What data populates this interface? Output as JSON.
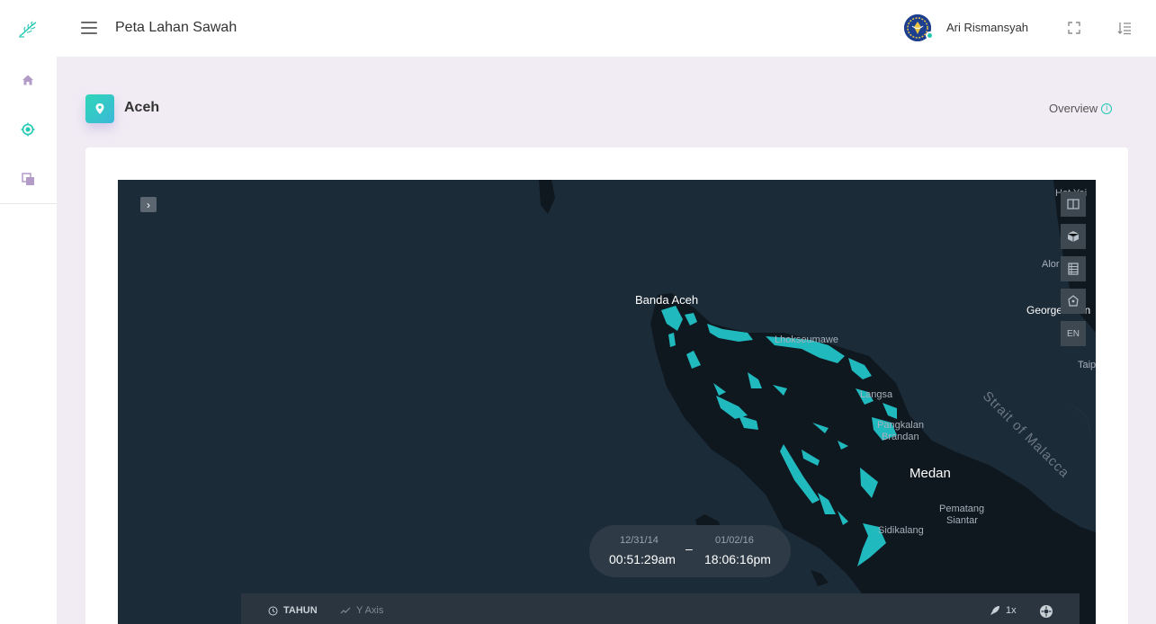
{
  "header": {
    "title": "Peta Lahan Sawah",
    "username": "Ari Rismansyah"
  },
  "page": {
    "title": "Aceh",
    "overview_label": "Overview"
  },
  "map": {
    "labels": {
      "banda_aceh": "Banda Aceh",
      "lhokseumawe": "Lhokseumawe",
      "langsa": "Langsa",
      "pangkalan_brandan_1": "Pangkalan",
      "pangkalan_brandan_2": "Brandan",
      "medan": "Medan",
      "pematang_siantar_1": "Pematang",
      "pematang_siantar_2": "Siantar",
      "sidikalang": "Sidikalang",
      "strait": "Strait of Malacca",
      "hat_yai": "Hat Yai",
      "alor": "Alor",
      "george_town": "George Town",
      "taip": "Taip"
    },
    "language_button": "EN",
    "time_range": {
      "start_date": "12/31/14",
      "start_time": "00:51:29am",
      "separator": "–",
      "end_date": "01/02/16",
      "end_time": "18:06:16pm"
    },
    "bottom_bar": {
      "field": "TAHUN",
      "y_axis": "Y Axis",
      "speed": "1x"
    },
    "colors": {
      "water": "#1c2b38",
      "land": "#0f171f",
      "rice_field": "#20b9be"
    }
  }
}
